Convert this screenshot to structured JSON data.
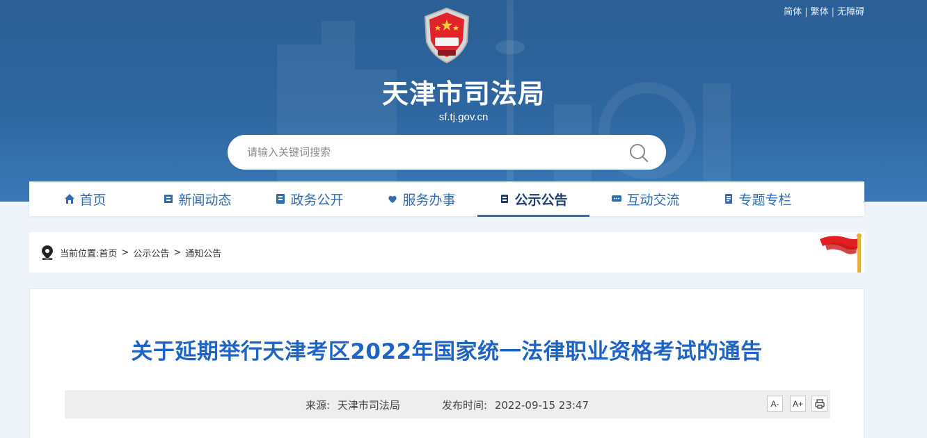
{
  "lang_links": [
    "简体",
    "繁体",
    "无障碍"
  ],
  "site": {
    "title": "天津市司法局",
    "domain": "sf.tj.gov.cn"
  },
  "search": {
    "placeholder": "请输入关键词搜索"
  },
  "nav": [
    {
      "label": "首页",
      "icon": "home-icon"
    },
    {
      "label": "新闻动态",
      "icon": "news-icon"
    },
    {
      "label": "政务公开",
      "icon": "document-icon"
    },
    {
      "label": "服务办事",
      "icon": "service-icon"
    },
    {
      "label": "公示公告",
      "icon": "notice-icon",
      "active": true
    },
    {
      "label": "互动交流",
      "icon": "chat-icon"
    },
    {
      "label": "专题专栏",
      "icon": "column-icon"
    }
  ],
  "breadcrumb": {
    "prefix": "当前位置:",
    "items": [
      "首页",
      "公示公告",
      "通知公告"
    ],
    "separator": ">"
  },
  "article": {
    "title": "关于延期举行天津考区2022年国家统一法律职业资格考试的通告",
    "source_label": "来源:",
    "source": "天津市司法局",
    "time_label": "发布时间:",
    "time": "2022-09-15 23:47"
  },
  "tools": {
    "decrease_font": "A-",
    "increase_font": "A+"
  },
  "colors": {
    "accent": "#2f6cb0",
    "title": "#1f64c4",
    "banner": "#2e66a0"
  }
}
